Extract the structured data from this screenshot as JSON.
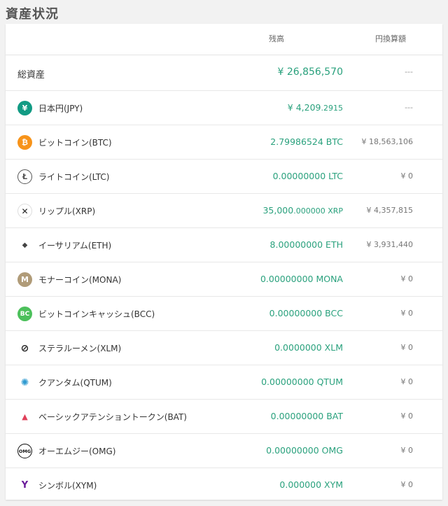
{
  "title": "資産状況",
  "headers": {
    "balance": "残高",
    "jpy_value": "円換算額"
  },
  "total": {
    "label": "総資産",
    "balance": "¥ 26,856,570",
    "jpy_value": "---"
  },
  "assets": [
    {
      "icon": "yen-icon",
      "glyph": "¥",
      "color": "#129b84",
      "name": "日本円(JPY)",
      "balance_main": "¥ 4,209",
      "balance_frac": ".2915",
      "jpy_value": "---"
    },
    {
      "icon": "bitcoin-icon",
      "glyph": "₿",
      "color": "#f7931a",
      "name": "ビットコイン(BTC)",
      "balance_main": "2.79986524 BTC",
      "balance_frac": "",
      "jpy_value": "¥ 18,563,106"
    },
    {
      "icon": "litecoin-icon",
      "glyph": "Ł",
      "color": "#ffffff",
      "name": "ライトコイン(LTC)",
      "balance_main": "0.00000000 LTC",
      "balance_frac": "",
      "jpy_value": "¥ 0"
    },
    {
      "icon": "xrp-icon",
      "glyph": "✕",
      "color": "#ffffff",
      "name": "リップル(XRP)",
      "balance_main": "35,000",
      "balance_frac": ".000000 XRP",
      "jpy_value": "¥ 4,357,815"
    },
    {
      "icon": "ethereum-icon",
      "glyph": "◆",
      "color": "#ffffff",
      "name": "イーサリアム(ETH)",
      "balance_main": "8.00000000 ETH",
      "balance_frac": "",
      "jpy_value": "¥ 3,931,440"
    },
    {
      "icon": "monacoin-icon",
      "glyph": "M",
      "color": "#b09b78",
      "name": "モナーコイン(MONA)",
      "balance_main": "0.00000000 MONA",
      "balance_frac": "",
      "jpy_value": "¥ 0"
    },
    {
      "icon": "bitcoincash-icon",
      "glyph": "BC",
      "color": "#4cc05b",
      "name": "ビットコインキャッシュ(BCC)",
      "balance_main": "0.00000000 BCC",
      "balance_frac": "",
      "jpy_value": "¥ 0"
    },
    {
      "icon": "stellar-icon",
      "glyph": "⊘",
      "color": "#ffffff",
      "name": "ステラルーメン(XLM)",
      "balance_main": "0.0000000 XLM",
      "balance_frac": "",
      "jpy_value": "¥ 0"
    },
    {
      "icon": "qtum-icon",
      "glyph": "✺",
      "color": "#ffffff",
      "name": "クアンタム(QTUM)",
      "balance_main": "0.00000000 QTUM",
      "balance_frac": "",
      "jpy_value": "¥ 0"
    },
    {
      "icon": "bat-icon",
      "glyph": "▲",
      "color": "#ffffff",
      "name": "ベーシックアテンショントークン(BAT)",
      "balance_main": "0.00000000 BAT",
      "balance_frac": "",
      "jpy_value": "¥ 0"
    },
    {
      "icon": "omisego-icon",
      "glyph": "OMG",
      "color": "#ffffff",
      "name": "オーエムジー(OMG)",
      "balance_main": "0.00000000 OMG",
      "balance_frac": "",
      "jpy_value": "¥ 0"
    },
    {
      "icon": "symbol-icon",
      "glyph": "Y",
      "color": "#ffffff",
      "name": "シンボル(XYM)",
      "balance_main": "0.000000 XYM",
      "balance_frac": "",
      "jpy_value": "¥ 0"
    }
  ]
}
